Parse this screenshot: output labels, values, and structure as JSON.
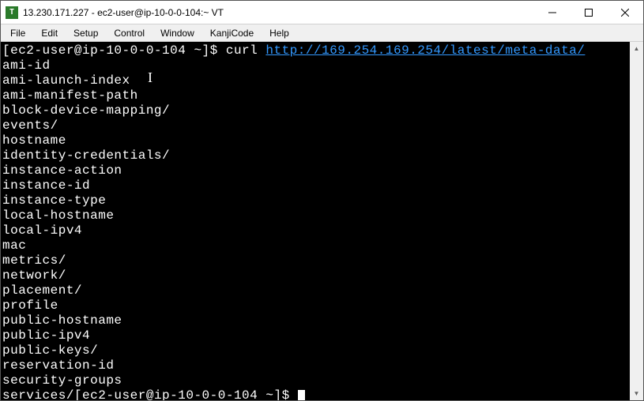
{
  "window": {
    "title": "13.230.171.227 - ec2-user@ip-10-0-0-104:~ VT",
    "icon_letter": "T"
  },
  "menu": {
    "items": [
      "File",
      "Edit",
      "Setup",
      "Control",
      "Window",
      "KanjiCode",
      "Help"
    ]
  },
  "terminal": {
    "prompt1": "[ec2-user@ip-10-0-0-104 ~]$ ",
    "command": "curl ",
    "url": "http://169.254.169.254/latest/meta-data/",
    "output_lines": [
      "ami-id",
      "ami-launch-index",
      "ami-manifest-path",
      "block-device-mapping/",
      "events/",
      "hostname",
      "identity-credentials/",
      "instance-action",
      "instance-id",
      "instance-type",
      "local-hostname",
      "local-ipv4",
      "mac",
      "metrics/",
      "network/",
      "placement/",
      "profile",
      "public-hostname",
      "public-ipv4",
      "public-keys/",
      "reservation-id",
      "security-groups"
    ],
    "last_line_prefix": "services/",
    "prompt2": "[ec2-user@ip-10-0-0-104 ~]$ "
  }
}
